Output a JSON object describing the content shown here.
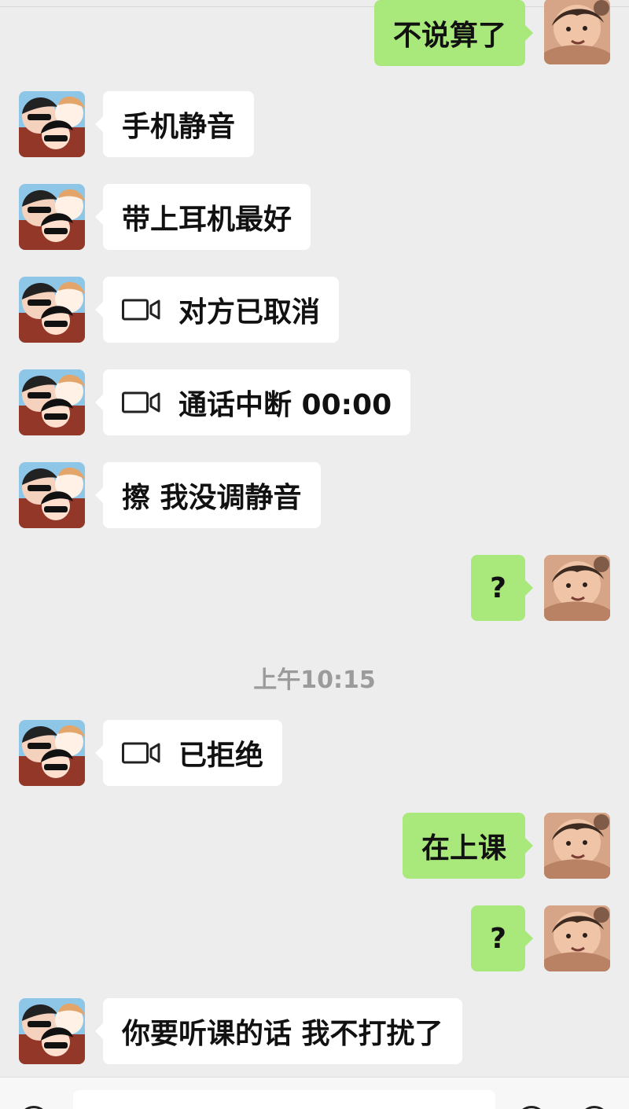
{
  "messages": [
    {
      "side": "right",
      "type": "text",
      "text": "不说算了"
    },
    {
      "side": "left",
      "type": "text",
      "text": "手机静音"
    },
    {
      "side": "left",
      "type": "text",
      "text": "带上耳机最好"
    },
    {
      "side": "left",
      "type": "video",
      "icon": "video-camera-icon",
      "text": "对方已取消"
    },
    {
      "side": "left",
      "type": "video",
      "icon": "video-camera-icon",
      "text": "通话中断 00:00"
    },
    {
      "side": "left",
      "type": "text",
      "text": "擦 我没调静音"
    },
    {
      "side": "right",
      "type": "text",
      "text": "?"
    },
    {
      "side": "center",
      "type": "time",
      "text": "上午10:15"
    },
    {
      "side": "left",
      "type": "video",
      "icon": "video-camera-icon",
      "text": "已拒绝"
    },
    {
      "side": "right",
      "type": "text",
      "text": "在上课"
    },
    {
      "side": "right",
      "type": "text",
      "text": "?"
    },
    {
      "side": "left",
      "type": "text",
      "text": "你要听课的话 我不打扰了"
    }
  ],
  "colors": {
    "background": "#ededed",
    "incoming_bubble": "#ffffff",
    "outgoing_bubble": "#a9e87a",
    "timestamp": "#9b9b9b",
    "text": "#111111"
  },
  "avatars": {
    "contact": "contact-avatar-icon",
    "self": "self-avatar-icon"
  },
  "input": {
    "voice_icon": "voice-icon",
    "emoji_icon": "emoji-icon",
    "plus_icon": "plus-icon"
  }
}
